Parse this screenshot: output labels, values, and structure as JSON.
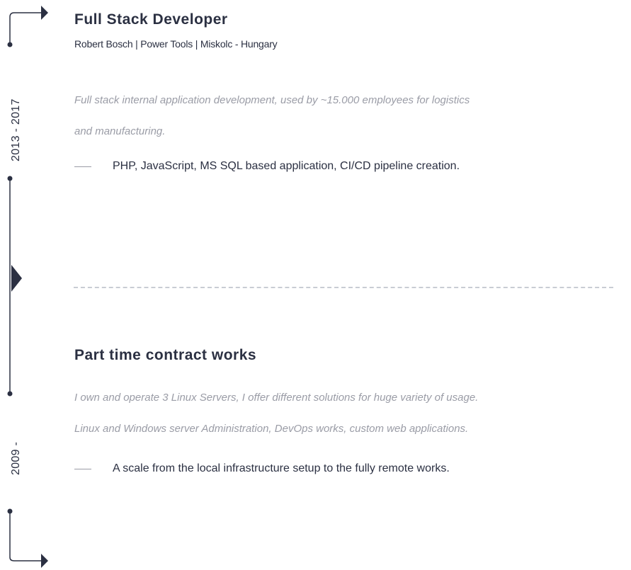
{
  "timeline": {
    "periods": [
      {
        "years": "2013 - 2017"
      },
      {
        "years": "2009 -"
      }
    ]
  },
  "jobs": [
    {
      "title": "Full Stack Developer",
      "company": "Robert Bosch | Power Tools | Miskolc - Hungary",
      "description": [
        "Full stack internal application development, used by ~15.000 employees for logistics",
        "and manufacturing."
      ],
      "bullets": [
        "PHP, JavaScript, MS SQL based application, CI/CD pipeline creation."
      ]
    },
    {
      "title": "Part time contract works",
      "description": [
        "I own and operate 3 Linux Servers, I offer different solutions for huge variety of usage.",
        "Linux and Windows server Administration, DevOps works, custom web applications."
      ],
      "bullets": [
        "A scale from the local infrastructure setup to the fully remote works."
      ]
    }
  ],
  "colors": {
    "primary": "#2b3042",
    "muted": "#9a9ca6",
    "separator": "#c9ccd4"
  }
}
